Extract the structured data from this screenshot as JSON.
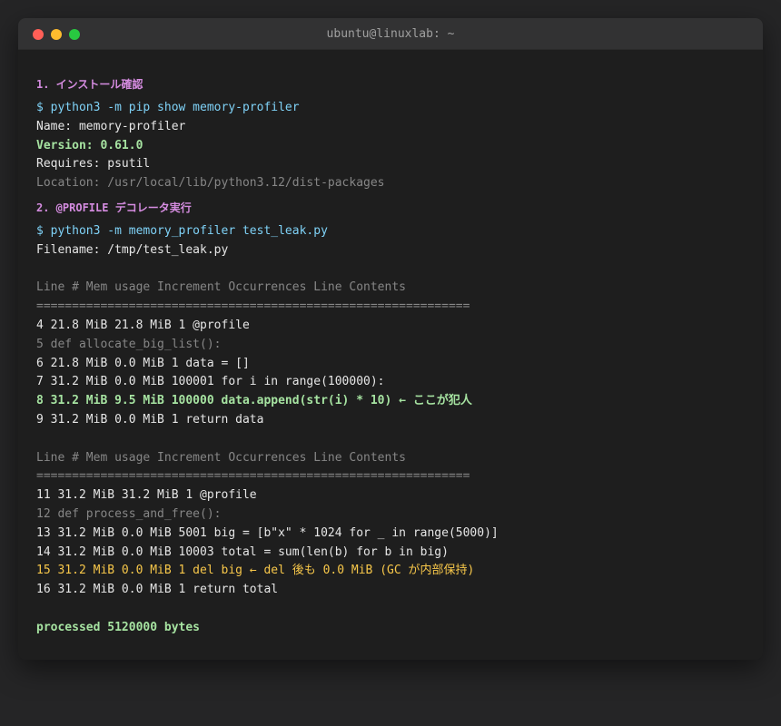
{
  "window": {
    "title": "ubuntu@linuxlab: ~"
  },
  "section1": {
    "heading": "1. インストール確認",
    "command": "$ python3 -m pip show memory-profiler",
    "name_line": "Name: memory-profiler",
    "version_line": "Version: 0.61.0",
    "requires_line": "Requires: psutil",
    "location_line": "Location: /usr/local/lib/python3.12/dist-packages"
  },
  "section2": {
    "heading": "2. @PROFILE デコレータ実行",
    "command": "$ python3 -m memory_profiler test_leak.py",
    "filename_line": "Filename: /tmp/test_leak.py"
  },
  "table1": {
    "header": "Line # Mem usage Increment Occurrences Line Contents",
    "separator": "=============================================================",
    "rows": [
      "4 21.8 MiB 21.8 MiB 1 @profile",
      "5 def allocate_big_list():",
      "6 21.8 MiB 0.0 MiB 1 data = []",
      "7 31.2 MiB 0.0 MiB 100001 for i in range(100000):",
      "8 31.2 MiB 9.5 MiB 100000 data.append(str(i) * 10) ← ここが犯人",
      "9 31.2 MiB 0.0 MiB 1 return data"
    ]
  },
  "table2": {
    "header": "Line # Mem usage Increment Occurrences Line Contents",
    "separator": "=============================================================",
    "rows": [
      "11 31.2 MiB 31.2 MiB 1 @profile",
      "12 def process_and_free():",
      "13 31.2 MiB 0.0 MiB 5001 big = [b\"x\" * 1024 for _ in range(5000)]",
      "14 31.2 MiB 0.0 MiB 10003 total = sum(len(b) for b in big)",
      "15 31.2 MiB 0.0 MiB 1 del big ← del 後も 0.0 MiB (GC が内部保持)",
      "16 31.2 MiB 0.0 MiB 1 return total"
    ]
  },
  "footer": {
    "result": "processed 5120000 bytes"
  },
  "colors": {
    "section_heading": "#d58ce0",
    "command": "#7fd2f7",
    "highlight_green": "#a6e3a1",
    "highlight_yellow": "#f7c74a"
  }
}
